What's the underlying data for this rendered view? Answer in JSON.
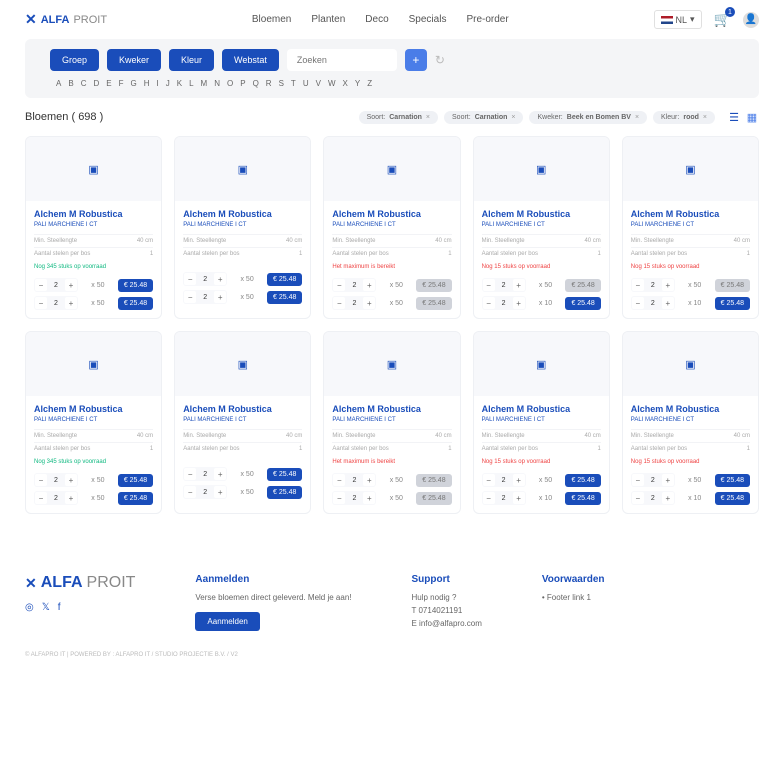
{
  "brand": {
    "name": "ALFA",
    "suffix": "PROIT"
  },
  "nav": [
    "Bloemen",
    "Planten",
    "Deco",
    "Specials",
    "Pre-order"
  ],
  "lang": "NL",
  "cart_count": "1",
  "filters": [
    "Groep",
    "Kweker",
    "Kleur",
    "Webstat"
  ],
  "search_placeholder": "Zoeken",
  "alphabet": [
    "A",
    "B",
    "C",
    "D",
    "E",
    "F",
    "G",
    "H",
    "I",
    "J",
    "K",
    "L",
    "M",
    "N",
    "O",
    "P",
    "Q",
    "R",
    "S",
    "T",
    "U",
    "V",
    "W",
    "X",
    "Y",
    "Z"
  ],
  "heading": "Bloemen ( 698 )",
  "tags": [
    {
      "k": "Soort:",
      "v": "Carnation"
    },
    {
      "k": "Soort:",
      "v": "Carnation"
    },
    {
      "k": "Kweker:",
      "v": "Beek en Bomen BV"
    },
    {
      "k": "Kleur:",
      "v": "rood"
    }
  ],
  "products": [
    {
      "status": "Nog 345 stuks op voorraad",
      "sc": "green",
      "rows": [
        {
          "q": "2",
          "m": "x 50",
          "p": "€ 25.48",
          "st": "b"
        },
        {
          "q": "2",
          "m": "x 50",
          "p": "€ 25.48",
          "st": "b"
        }
      ]
    },
    {
      "status": "",
      "sc": "",
      "rows": [
        {
          "q": "2",
          "m": "x 50",
          "p": "€ 25.48",
          "st": "b"
        },
        {
          "q": "2",
          "m": "x 50",
          "p": "€ 25.48",
          "st": "b"
        }
      ]
    },
    {
      "status": "Het maximum is bereikt",
      "sc": "red",
      "rows": [
        {
          "q": "2",
          "m": "x 50",
          "p": "€ 25.48",
          "st": "g"
        },
        {
          "q": "2",
          "m": "x 50",
          "p": "€ 25.48",
          "st": "g"
        }
      ]
    },
    {
      "status": "Nog 15 stuks op voorraad",
      "sc": "red",
      "rows": [
        {
          "q": "2",
          "m": "x 50",
          "p": "€ 25.48",
          "st": "g"
        },
        {
          "q": "2",
          "m": "x 10",
          "p": "€ 25.48",
          "st": "b"
        }
      ]
    },
    {
      "status": "Nog 15 stuks op voorraad",
      "sc": "red",
      "rows": [
        {
          "q": "2",
          "m": "x 50",
          "p": "€ 25.48",
          "st": "g"
        },
        {
          "q": "2",
          "m": "x 10",
          "p": "€ 25.48",
          "st": "b"
        }
      ]
    },
    {
      "status": "Nog 345 stuks op voorraad",
      "sc": "green",
      "rows": [
        {
          "q": "2",
          "m": "x 50",
          "p": "€ 25.48",
          "st": "b"
        },
        {
          "q": "2",
          "m": "x 50",
          "p": "€ 25.48",
          "st": "b"
        }
      ]
    },
    {
      "status": "",
      "sc": "",
      "rows": [
        {
          "q": "2",
          "m": "x 50",
          "p": "€ 25.48",
          "st": "b"
        },
        {
          "q": "2",
          "m": "x 50",
          "p": "€ 25.48",
          "st": "b"
        }
      ]
    },
    {
      "status": "Het maximum is bereikt",
      "sc": "red",
      "rows": [
        {
          "q": "2",
          "m": "x 50",
          "p": "€ 25.48",
          "st": "g"
        },
        {
          "q": "2",
          "m": "x 50",
          "p": "€ 25.48",
          "st": "g"
        }
      ]
    },
    {
      "status": "Nog 15 stuks op voorraad",
      "sc": "red",
      "rows": [
        {
          "q": "2",
          "m": "x 50",
          "p": "€ 25.48",
          "st": "b"
        },
        {
          "q": "2",
          "m": "x 10",
          "p": "€ 25.48",
          "st": "b"
        }
      ]
    },
    {
      "status": "Nog 15 stuks op voorraad",
      "sc": "red",
      "rows": [
        {
          "q": "2",
          "m": "x 50",
          "p": "€ 25.48",
          "st": "b"
        },
        {
          "q": "2",
          "m": "x 10",
          "p": "€ 25.48",
          "st": "b"
        }
      ]
    }
  ],
  "card": {
    "title": "Alchem M Robustica",
    "sub": "PALI MARCHIENE I CT",
    "m1k": "Min. Steellengte",
    "m1v": "40 cm",
    "m2k": "Aantal stelen per bos",
    "m2v": "1"
  },
  "footer": {
    "signup_h": "Aanmelden",
    "signup_t": "Verse bloemen direct geleverd. Meld je aan!",
    "signup_btn": "Aanmelden",
    "support_h": "Support",
    "support_q": "Hulp nodig ?",
    "support_tel": "T 0714021191",
    "support_mail": "E info@alfapro.com",
    "terms_h": "Voorwaarden",
    "terms_l": "Footer link 1"
  },
  "copyright": "© ALFAPRO IT | POWERED BY : ALFAPRO IT / STUDIO PROJECTIE B.V. / V2"
}
